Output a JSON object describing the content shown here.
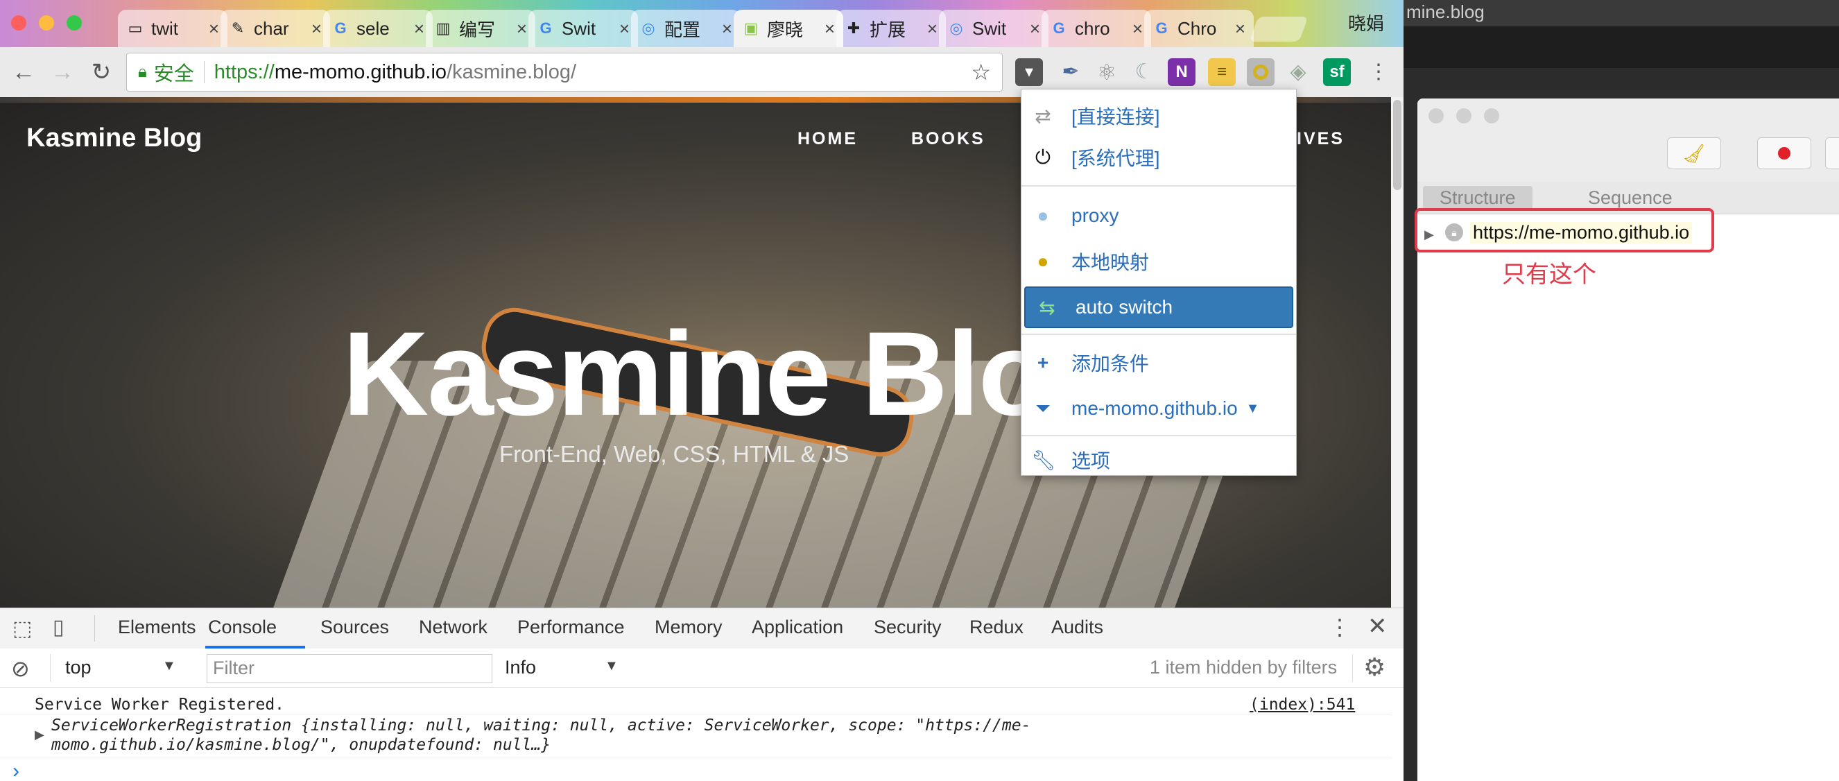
{
  "browser": {
    "tabs": [
      {
        "label": "twit",
        "icon": "document-icon"
      },
      {
        "label": "char",
        "icon": "quill-icon"
      },
      {
        "label": "sele",
        "icon": "google-icon"
      },
      {
        "label": "编写",
        "icon": "book-icon"
      },
      {
        "label": "Swit",
        "icon": "google-icon"
      },
      {
        "label": "配置",
        "icon": "circle-icon"
      },
      {
        "label": "廖晓",
        "icon": "android-icon"
      },
      {
        "label": "扩展",
        "icon": "puzzle-icon"
      },
      {
        "label": "Swit",
        "icon": "circle-icon"
      },
      {
        "label": "chro",
        "icon": "google-icon"
      },
      {
        "label": "Chro",
        "icon": "google-icon"
      }
    ],
    "profile_label": "晓娟",
    "close_glyph": "×",
    "url": {
      "secure_label": "安全",
      "scheme": "https://",
      "host": "me-momo.github.io",
      "path": "/kasmine.blog/"
    },
    "accent_color": "#2a8a2a"
  },
  "page": {
    "brand": "Kasmine Blog",
    "nav": [
      "HOME",
      "BOOKS",
      "IVES"
    ],
    "hero_title": "Kasmine Blog",
    "hero_subtitle": "Front-End, Web, CSS, HTML & JS"
  },
  "proxy_menu": {
    "items": [
      {
        "label": "[直接连接]",
        "icon": "direct-arrows-icon"
      },
      {
        "label": "[系统代理]",
        "icon": "power-icon"
      },
      {
        "label": "proxy",
        "icon": "globe-icon"
      },
      {
        "label": "本地映射",
        "icon": "globe-yellow-icon"
      },
      {
        "label": "auto switch",
        "icon": "auto-switch-icon",
        "selected": true
      },
      {
        "label": "添加条件",
        "icon": "plus-icon"
      },
      {
        "label": "me-momo.github.io",
        "icon": "filter-icon"
      },
      {
        "label": "选项",
        "icon": "wrench-icon"
      }
    ],
    "selected_color": "#337ab7"
  },
  "devtools": {
    "tabs": [
      "Elements",
      "Console",
      "Sources",
      "Network",
      "Performance",
      "Memory",
      "Application",
      "Security",
      "Redux",
      "Audits"
    ],
    "active_tab": "Console",
    "context": "top",
    "filter_placeholder": "Filter",
    "level": "Info",
    "hidden_note": "1 item hidden by filters",
    "console": {
      "line1": "Service Worker Registered.",
      "line1_source": "(index):541",
      "obj_name": "ServiceWorkerRegistration",
      "obj_line1": "{installing: null, waiting: null, active: ServiceWorker, scope: \"https://me-",
      "obj_line2": "momo.github.io/kasmine.blog/\", onupdatefound: null…}",
      "prompt": "›"
    }
  },
  "right_window": {
    "title_fragment": "mine.blog",
    "tabs": [
      "Structure",
      "Sequence"
    ],
    "tree_item": "https://me-momo.github.io",
    "annotation": "只有这个",
    "annotation_color": "#e03b4b"
  }
}
